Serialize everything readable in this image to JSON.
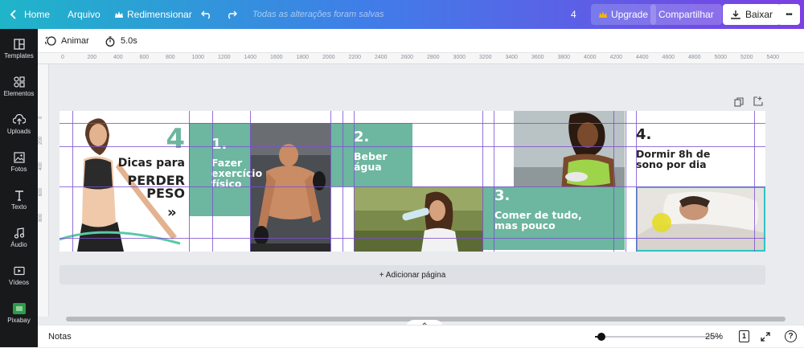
{
  "topbar": {
    "home": "Home",
    "file": "Arquivo",
    "resize": "Redimensionar",
    "saved_status": "Todas as alterações foram salvas",
    "count": "4",
    "upgrade": "Upgrade",
    "share": "Compartilhar",
    "download": "Baixar",
    "more": "•••"
  },
  "sidebar": {
    "items": [
      {
        "label": "Templates",
        "icon": "templates-icon"
      },
      {
        "label": "Elementos",
        "icon": "elements-icon"
      },
      {
        "label": "Uploads",
        "icon": "upload-icon"
      },
      {
        "label": "Fotos",
        "icon": "photos-icon"
      },
      {
        "label": "Texto",
        "icon": "text-icon"
      },
      {
        "label": "Áudio",
        "icon": "audio-icon"
      },
      {
        "label": "Vídeos",
        "icon": "video-icon"
      },
      {
        "label": "Pixabay",
        "icon": "pixabay-icon"
      }
    ]
  },
  "toolbar": {
    "animate": "Animar",
    "duration": "5.0s"
  },
  "ruler": {
    "top_ticks": [
      "0",
      "200",
      "400",
      "600",
      "800",
      "1000",
      "1200",
      "1400",
      "1600",
      "1800",
      "2000",
      "2200",
      "2400",
      "2600",
      "2800",
      "3000",
      "3200",
      "3400",
      "3600",
      "3800",
      "4000",
      "4200",
      "4400",
      "4600",
      "4800",
      "5000",
      "5200",
      "5400"
    ],
    "left_ticks": [
      "0",
      "200",
      "400",
      "600",
      "800"
    ]
  },
  "design": {
    "intro_number": "4",
    "intro_title": "Dicas para",
    "intro_big": "PERDER\nPESO",
    "arrows": "»",
    "tip1_num": "1.",
    "tip1_text": "Fazer\nexercício\nfísico",
    "tip2_num": "2.",
    "tip2_text": "Beber\nágua",
    "tip3_num": "3.",
    "tip3_text": "Comer de tudo,\nmas pouco",
    "tip4_num": "4.",
    "tip4_text": "Dormir 8h de\nsono por dia"
  },
  "add_page": "+ Adicionar página",
  "bottombar": {
    "notes": "Notas",
    "zoom": "25%",
    "page_indicator": "1",
    "zoom_level": 0.05
  },
  "colors": {
    "teal": "#6db6a0",
    "guide": "#7a4fd0",
    "selection": "#2ec4c4",
    "sidebar_bg": "#18191b"
  }
}
